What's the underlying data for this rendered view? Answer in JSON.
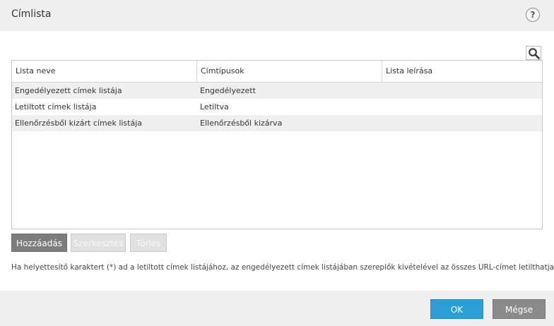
{
  "dialog": {
    "title": "Címlista",
    "help_label": "?"
  },
  "table": {
    "columns": [
      "Lista neve",
      "Címtípusok",
      "Lista leírása"
    ],
    "rows": [
      {
        "name": "Engedélyezett címek listája",
        "type": "Engedélyezett",
        "description": ""
      },
      {
        "name": "Letiltott címek listája",
        "type": "Letiltva",
        "description": ""
      },
      {
        "name": "Ellenőrzésből kizárt címek listája",
        "type": "Ellenőrzésből kizárva",
        "description": ""
      }
    ]
  },
  "actions": {
    "add_label": "Hozzáadás",
    "edit_label": "Szerkesztés",
    "delete_label": "Törlés"
  },
  "note": "Ha helyettesítő karaktert (*) ad a letiltott címek listájához, az engedélyezett címek listájában szereplők kivételével az összes URL-címet letilthatja.",
  "footer": {
    "ok_label": "OK",
    "cancel_label": "Mégse"
  },
  "icons": {
    "search": "search-icon",
    "help": "help-icon"
  },
  "colors": {
    "ok_button": "#2a9fd6",
    "cancel_button": "#8a8a8a",
    "add_button": "#7d7d7d",
    "disabled_button": "#e0e0e0",
    "title_bar": "#efefef"
  }
}
